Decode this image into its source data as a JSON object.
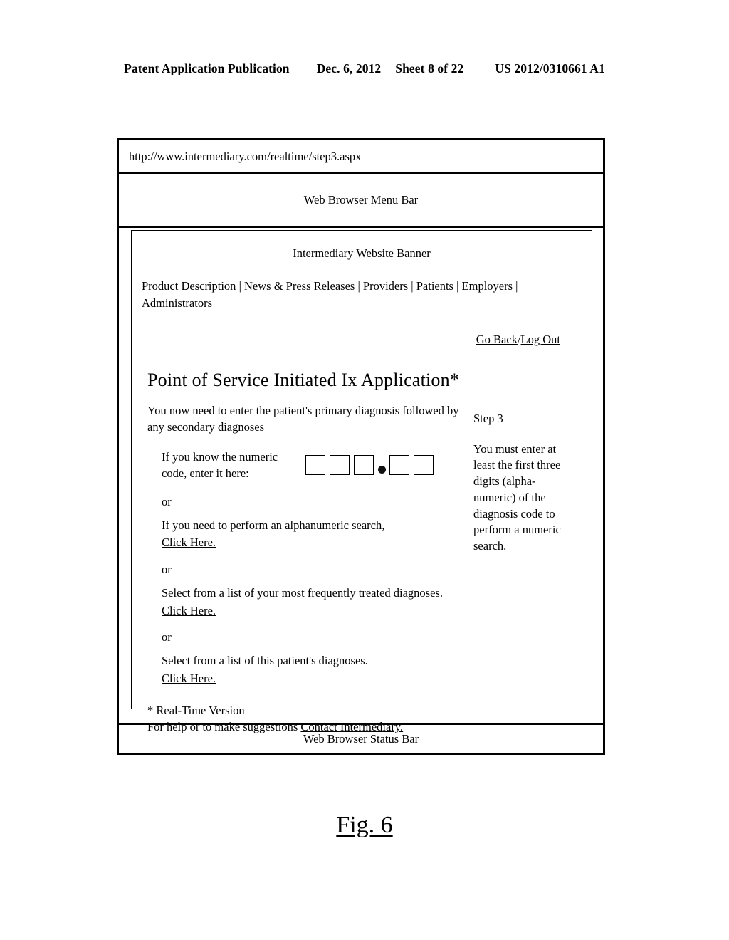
{
  "patent_header": {
    "publication": "Patent Application Publication",
    "date": "Dec. 6, 2012",
    "sheet": "Sheet 8 of 22",
    "number": "US 2012/0310661 A1"
  },
  "browser": {
    "url": "http://www.intermediary.com/realtime/step3.aspx",
    "menu_bar_label": "Web Browser Menu Bar",
    "status_bar_label": "Web Browser Status Bar"
  },
  "site": {
    "banner_title": "Intermediary Website Banner",
    "nav_items": [
      "Product Description",
      "News & Press Releases",
      "Providers",
      "Patients",
      "Employers",
      "Administrators"
    ],
    "nav_separator": "|",
    "toolbar": {
      "go_back": "Go Back",
      "separator": "/",
      "log_out": "Log Out"
    }
  },
  "app": {
    "title": "Point of Service Initiated Ix Application*",
    "lead_text": "You now need to enter the patient's primary diagnosis followed by any secondary diagnoses",
    "numeric_entry": {
      "label": "If you know the numeric code, enter it here:",
      "boxes_before_dot": 3,
      "boxes_after_dot": 2,
      "box_values": [
        "",
        "",
        "",
        "",
        ""
      ],
      "decimal_point": "."
    },
    "or_label": "or",
    "options": [
      {
        "text": "If you need to perform an alphanumeric search,",
        "link": "Click Here."
      },
      {
        "text": "Select from a list of your most frequently treated diagnoses.",
        "link": "Click Here."
      },
      {
        "text": "Select from a list of this patient's diagnoses.",
        "link": "Click Here."
      }
    ],
    "footnote": "* Real-Time Version",
    "help_text": "For help or to make suggestions",
    "help_link": "Contact Intermediary."
  },
  "sidebar": {
    "step_label": "Step 3",
    "instruction": "You must enter at least the first three digits (alpha-numeric) of the diagnosis code to perform a numeric search."
  },
  "figure": {
    "caption": "Fig. 6"
  }
}
